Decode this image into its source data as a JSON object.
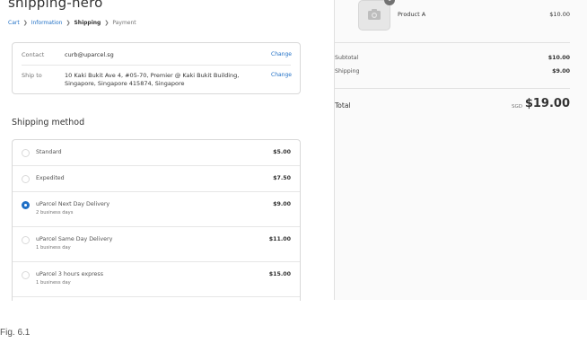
{
  "header": {
    "store_name": "shipping-hero",
    "breadcrumb": [
      "Cart",
      "Information",
      "Shipping",
      "Payment"
    ]
  },
  "review": {
    "contact": {
      "label": "Contact",
      "value": "curb@uparcel.sg",
      "change": "Change"
    },
    "ship_to": {
      "label": "Ship to",
      "value_line1": "10 Kaki Bukit Ave 4, #05-70, Premier @ Kaki Bukit Building,",
      "value_line2": "Singapore, Singapore 415874, Singapore",
      "change": "Change"
    }
  },
  "shipping": {
    "title": "Shipping method",
    "selected_index": 2,
    "methods": [
      {
        "name": "Standard",
        "sub": "",
        "price": "$5.00"
      },
      {
        "name": "Expedited",
        "sub": "",
        "price": "$7.50"
      },
      {
        "name": "uParcel Next Day Delivery",
        "sub": "2 business days",
        "price": "$9.00"
      },
      {
        "name": "uParcel Same Day Delivery",
        "sub": "1 business day",
        "price": "$11.00"
      },
      {
        "name": "uParcel 3 hours express",
        "sub": "1 business day",
        "price": "$15.00"
      }
    ]
  },
  "summary": {
    "product": {
      "name": "Product A",
      "price": "$10.00",
      "qty": "1",
      "icon": "camera-icon"
    },
    "subtotal_label": "Subtotal",
    "subtotal_value": "$10.00",
    "shipping_label": "Shipping",
    "shipping_value": "$9.00",
    "total_label": "Total",
    "total_currency": "SGD",
    "total_value": "$19.00"
  },
  "caption": "Fig. 6.1",
  "colors": {
    "accent": "#1f6fc5",
    "sidebar_bg": "#fafafa",
    "border": "#d9d9d9"
  }
}
